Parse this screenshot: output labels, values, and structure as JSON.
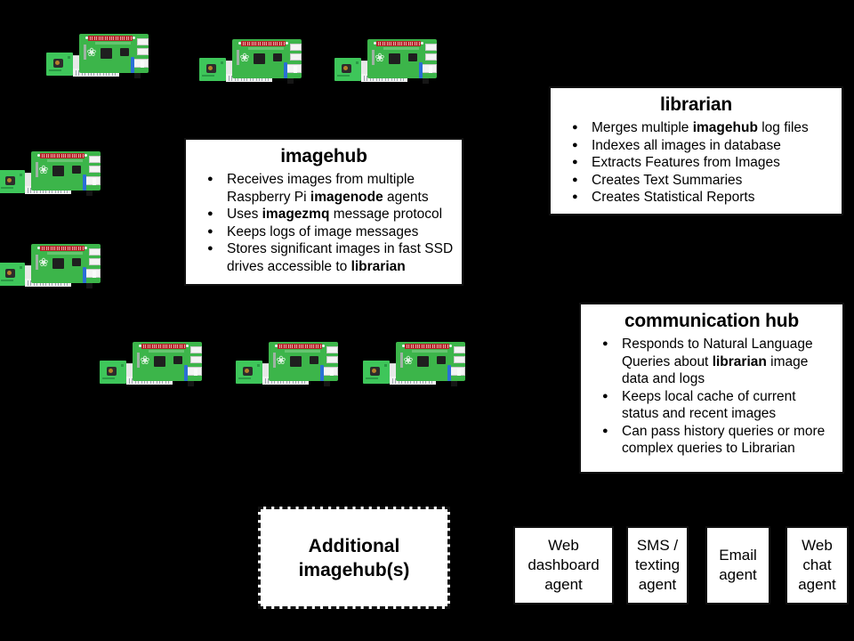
{
  "diagram": {
    "background_color": "#000000",
    "box_fill": "#ffffff",
    "box_border": "#111111",
    "pi_board_color": "#3cb54a",
    "pi_header_color": "#b3252a"
  },
  "nodes": {
    "label": "raspberry-pi-imagenode",
    "count": 8
  },
  "imagehub": {
    "title": "imagehub",
    "bullets": [
      [
        {
          "t": "Receives images from multiple "
        },
        {
          "t": "Raspberry Pi "
        },
        {
          "t": "imagenode",
          "b": true
        },
        {
          "t": " agents"
        }
      ],
      [
        {
          "t": "Uses "
        },
        {
          "t": "imagezmq",
          "b": true
        },
        {
          "t": " message protocol"
        }
      ],
      [
        {
          "t": "Keeps logs of image messages"
        }
      ],
      [
        {
          "t": "Stores significant images in fast SSD drives accessible to "
        },
        {
          "t": "librarian",
          "b": true
        }
      ]
    ]
  },
  "librarian": {
    "title": "librarian",
    "bullets": [
      [
        {
          "t": "Merges multiple "
        },
        {
          "t": "imagehub",
          "b": true
        },
        {
          "t": " log files"
        }
      ],
      [
        {
          "t": "Indexes all images in database"
        }
      ],
      [
        {
          "t": "Extracts Features from Images"
        }
      ],
      [
        {
          "t": "Creates Text Summaries"
        }
      ],
      [
        {
          "t": "Creates Statistical Reports"
        }
      ]
    ]
  },
  "communication_hub": {
    "title": "communication hub",
    "bullets": [
      [
        {
          "t": "Responds to Natural Language Queries about "
        },
        {
          "t": "librarian",
          "b": true
        },
        {
          "t": " image data and logs"
        }
      ],
      [
        {
          "t": "Keeps local cache of current status and recent images"
        }
      ],
      [
        {
          "t": "Can pass history queries or more complex queries to Librarian"
        }
      ]
    ]
  },
  "additional_imagehubs": {
    "line1": "Additional",
    "line2": "imagehub(s)",
    "border_style": "dashed"
  },
  "agents": [
    {
      "name": "web-dashboard-agent",
      "lines": [
        "Web",
        "dashboard",
        "agent"
      ]
    },
    {
      "name": "sms-texting-agent",
      "lines": [
        "SMS /",
        "texting",
        "agent"
      ]
    },
    {
      "name": "email-agent",
      "lines": [
        "Email",
        "agent"
      ]
    },
    {
      "name": "web-chat-agent",
      "lines": [
        "Web",
        "chat",
        "agent"
      ]
    }
  ]
}
